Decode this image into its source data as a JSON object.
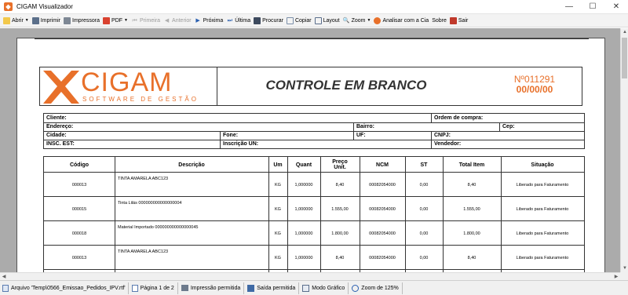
{
  "window": {
    "title": "CIGAM Visualizador",
    "icon": "cigam-app-icon"
  },
  "toolbar": {
    "items": [
      {
        "label": "Abrir",
        "icon": "folder-icon",
        "caret": true,
        "disabled": false
      },
      {
        "label": "Imprimir",
        "icon": "printer-icon",
        "caret": false,
        "disabled": false
      },
      {
        "label": "Impressora",
        "icon": "printer-settings-icon",
        "caret": false,
        "disabled": false
      },
      {
        "label": "PDF",
        "icon": "pdf-icon",
        "caret": true,
        "disabled": false
      },
      {
        "label": "Primeira",
        "icon": "first-page-icon",
        "caret": false,
        "disabled": true
      },
      {
        "label": "Anterior",
        "icon": "previous-page-icon",
        "caret": false,
        "disabled": true
      },
      {
        "label": "Próxima",
        "icon": "next-page-icon",
        "caret": false,
        "disabled": false
      },
      {
        "label": "Última",
        "icon": "last-page-icon",
        "caret": false,
        "disabled": false
      },
      {
        "label": "Procurar",
        "icon": "binoculars-icon",
        "caret": false,
        "disabled": false
      },
      {
        "label": "Copiar",
        "icon": "copy-icon",
        "caret": false,
        "disabled": false
      },
      {
        "label": "Layout",
        "icon": "layout-icon",
        "caret": false,
        "disabled": false
      },
      {
        "label": "Zoom",
        "icon": "zoom-icon",
        "caret": true,
        "disabled": false
      },
      {
        "label": "Analisar com a Cia",
        "icon": "analyze-icon",
        "caret": false,
        "disabled": false
      },
      {
        "label": "Sobre",
        "icon": "",
        "caret": false,
        "disabled": false
      },
      {
        "label": "Sair",
        "icon": "exit-icon",
        "caret": false,
        "disabled": false
      }
    ]
  },
  "document": {
    "logo_text": "CIGAM",
    "logo_subtext": "SOFTWARE DE GESTÃO",
    "title": "CONTROLE EM BRANCO",
    "number": "Nº011291",
    "date": "00/00/00",
    "info": {
      "cliente": "Cliente:",
      "ordem_compra": "Ordem de compra:",
      "endereco": "Endereço:",
      "bairro": "Bairro:",
      "cep": "Cep:",
      "cidade": "Cidade:",
      "fone": "Fone:",
      "uf": "UF:",
      "cnpj": "CNPJ:",
      "insc_est": "INSC. EST:",
      "inscricao_un": "Inscrição UN:",
      "vendedor": "Vendedor:"
    },
    "table": {
      "headers": {
        "codigo": "Código",
        "descricao": "Descrição",
        "um": "Um",
        "quant": "Quant",
        "preco_unit": "Preço Unit.",
        "ncm": "NCM",
        "st": "ST",
        "total_item": "Total Item",
        "situacao": "Situação"
      },
      "rows": [
        {
          "codigo": "000013",
          "descricao": "TINTA AMARELA ABC123",
          "um": "KG",
          "quant": "1,000000",
          "preco": "8,40",
          "ncm": "00082054000",
          "st": "0,00",
          "total": "8,40",
          "situacao": "Liberado para Faturamento"
        },
        {
          "codigo": "000015",
          "descricao": "Tinta Lilás 000000000000000004",
          "um": "KG",
          "quant": "1,000000",
          "preco": "1.555,00",
          "ncm": "00082054000",
          "st": "0,00",
          "total": "1.555,00",
          "situacao": "Liberado para Faturamento"
        },
        {
          "codigo": "000018",
          "descricao": "Material Importado 000000000000000045",
          "um": "KG",
          "quant": "1,000000",
          "preco": "1.800,00",
          "ncm": "00082054000",
          "st": "0,00",
          "total": "1.800,00",
          "situacao": "Liberado para Faturamento"
        },
        {
          "codigo": "000013",
          "descricao": "TINTA AMARELA ABC123",
          "um": "KG",
          "quant": "1,000000",
          "preco": "8,40",
          "ncm": "00082054000",
          "st": "0,00",
          "total": "8,40",
          "situacao": "Liberado para Faturamento"
        }
      ]
    }
  },
  "statusbar": {
    "file": "Arquivo 'Temp\\0566_Emissao_Pedidos_IPV.rtf'",
    "page": "Página 1 de 2",
    "print": "Impressão permitida",
    "output": "Saída permitida",
    "mode": "Modo Gráfico",
    "zoom": "Zoom de 125%"
  },
  "colors": {
    "brand": "#e8702a",
    "viewer_bg": "#ababab"
  }
}
